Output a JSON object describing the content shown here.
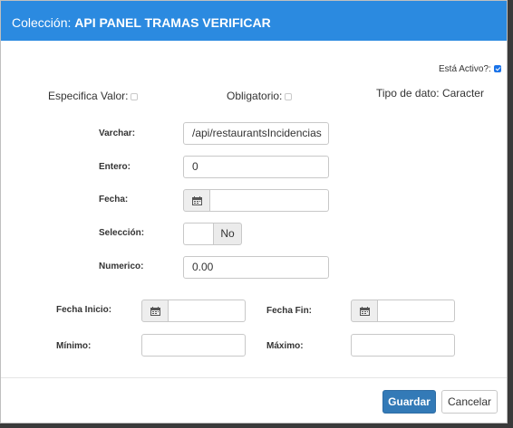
{
  "header": {
    "prefix": "Colección: ",
    "title": "API PANEL TRAMAS VERIFICAR"
  },
  "active": {
    "label": "Está Activo?:",
    "checked": true
  },
  "specific_value": {
    "label": "Especifica Valor:",
    "checked": false
  },
  "required": {
    "label": "Obligatorio:",
    "checked": false
  },
  "data_type": {
    "label": "Tipo de dato:",
    "value": "Caracter"
  },
  "fields": {
    "varchar": {
      "label": "Varchar:",
      "value": "/api/restaurantsIncidencias"
    },
    "entero": {
      "label": "Entero:",
      "value": "0"
    },
    "fecha": {
      "label": "Fecha:",
      "value": ""
    },
    "seleccion": {
      "label": "Selección:",
      "value": "No"
    },
    "numerico": {
      "label": "Numerico:",
      "value": "0.00"
    }
  },
  "range": {
    "fecha_inicio": {
      "label": "Fecha Inicio:",
      "value": ""
    },
    "fecha_fin": {
      "label": "Fecha Fin:",
      "value": ""
    },
    "minimo": {
      "label": "Mínimo:",
      "value": ""
    },
    "maximo": {
      "label": "Máximo:",
      "value": ""
    }
  },
  "footer": {
    "save_label": "Guardar",
    "cancel_label": "Cancelar"
  },
  "colors": {
    "header_bg": "#2b8ae0",
    "primary_button": "#337ab7",
    "checkbox_checked": "#1a73e8"
  },
  "icons": {
    "calendar": "calendar-icon"
  }
}
